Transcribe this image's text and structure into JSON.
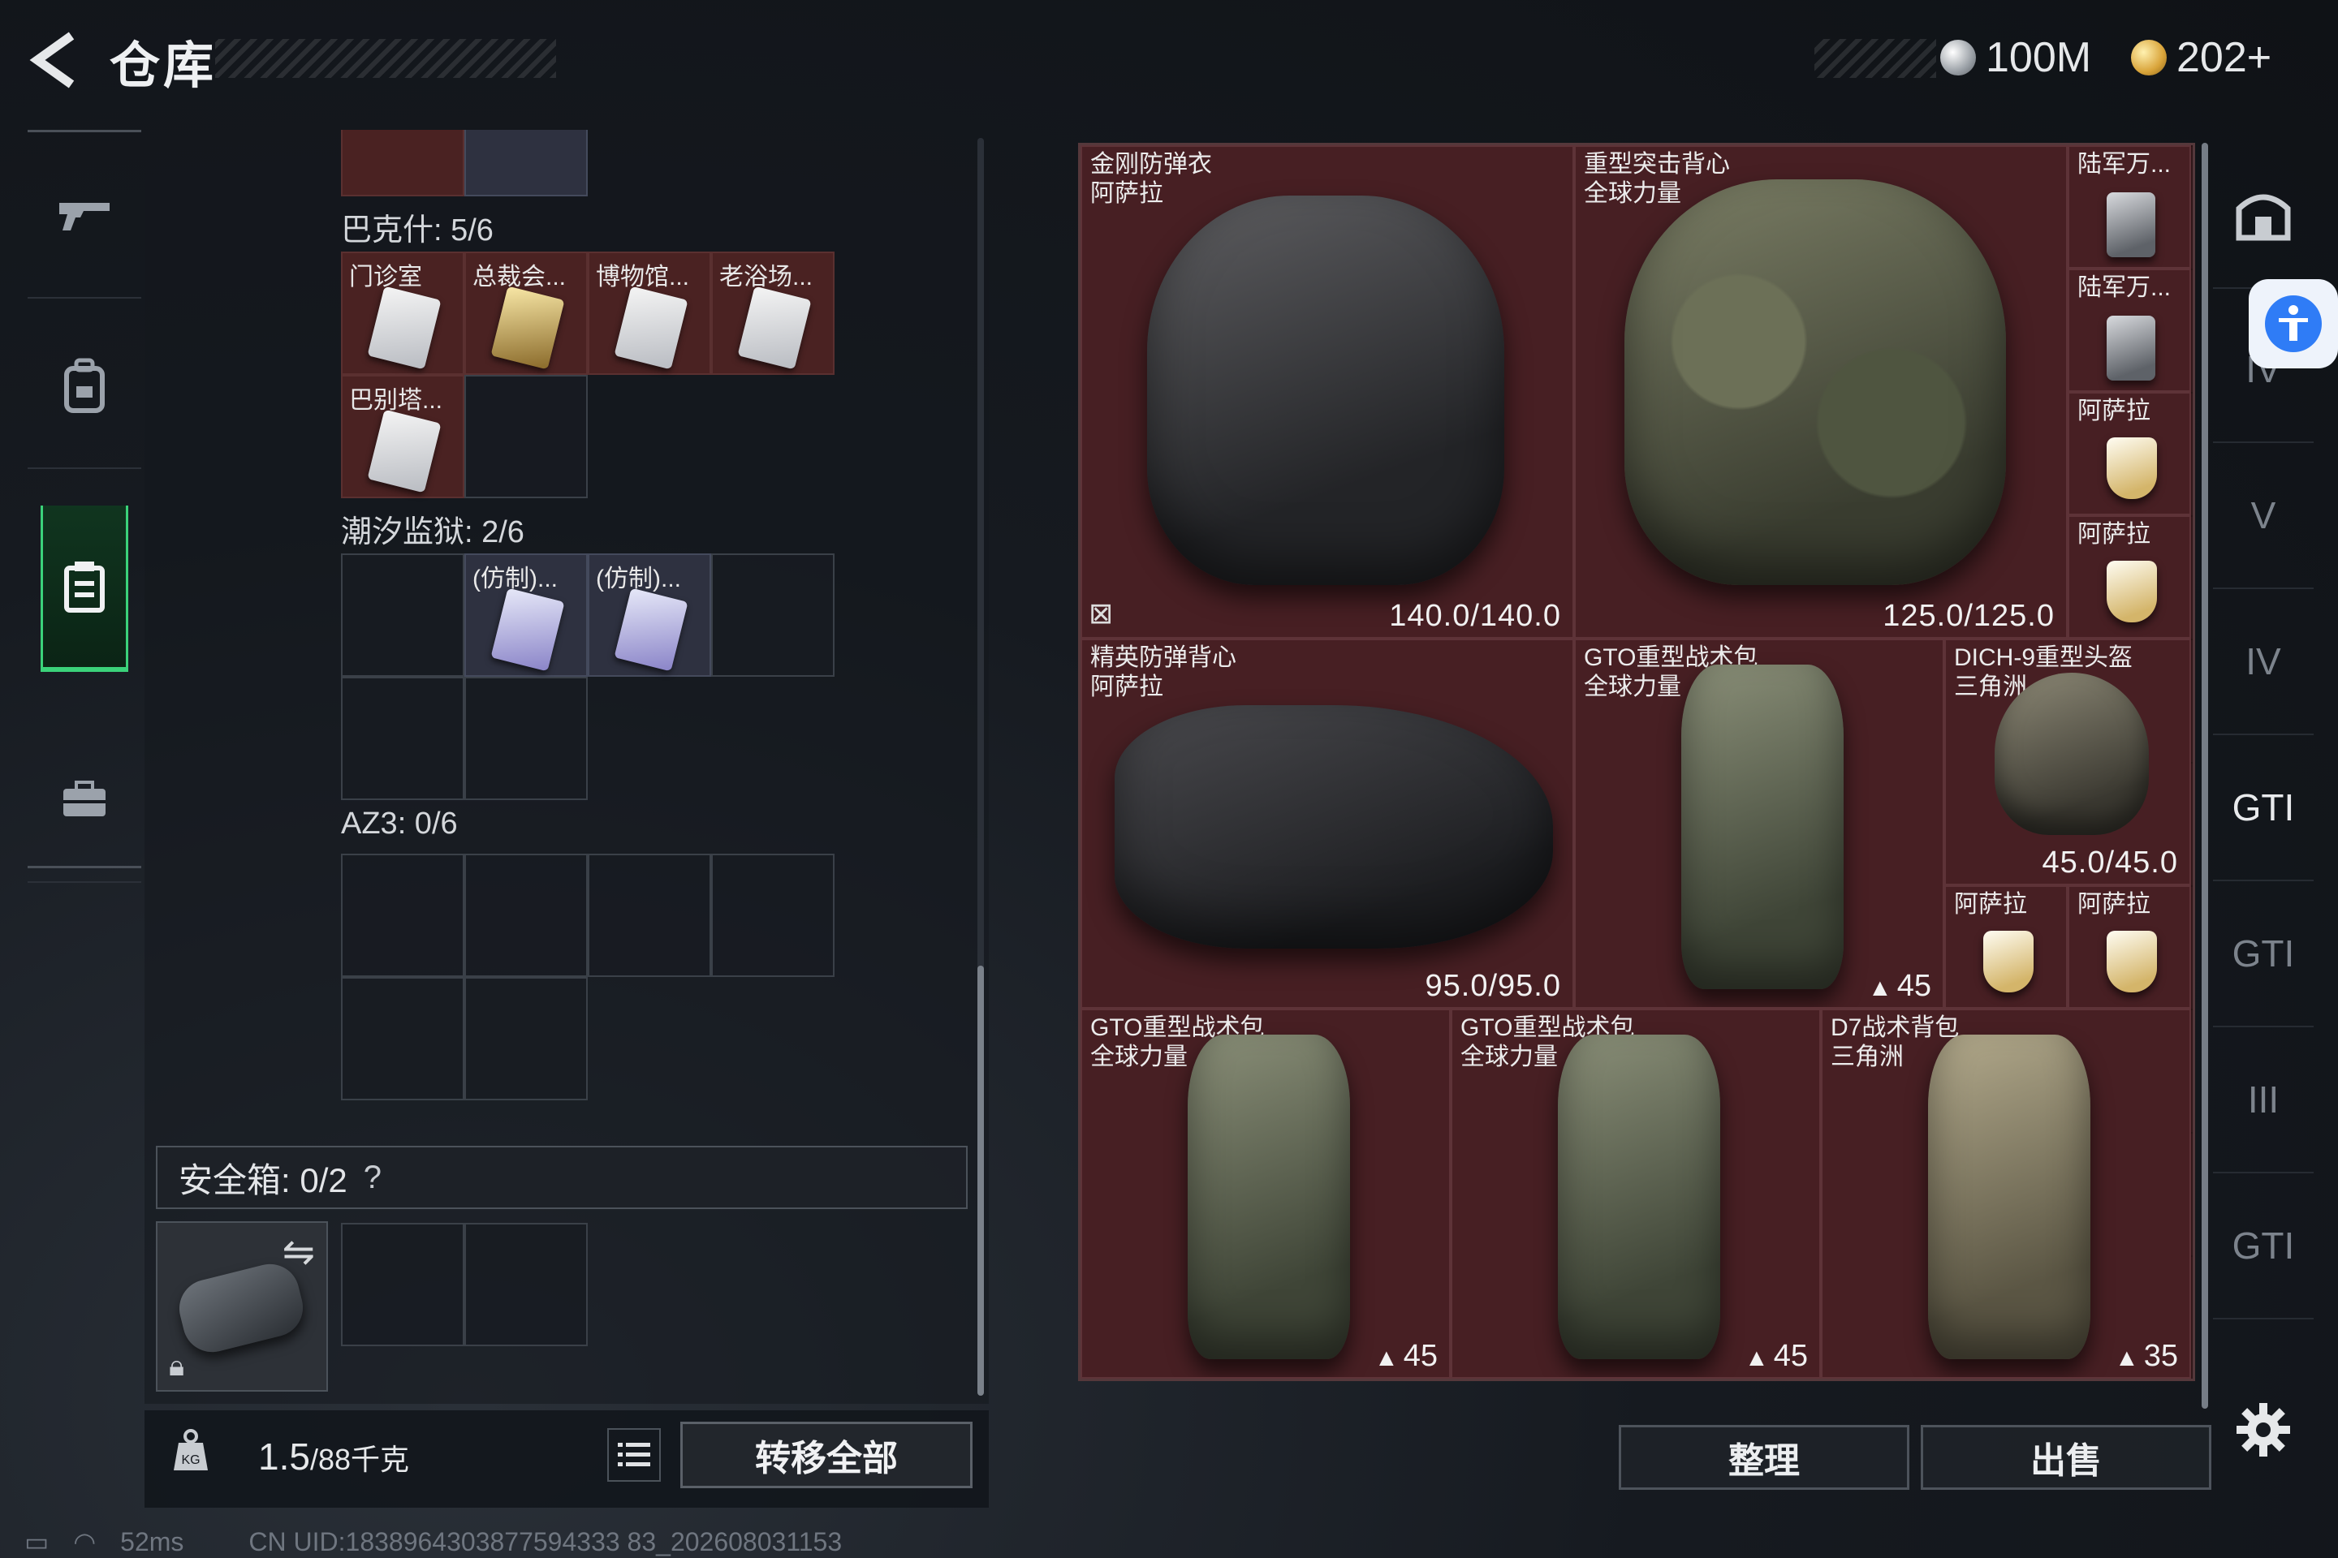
{
  "header": {
    "back_icon": "chevron-left-icon",
    "title": "仓库",
    "currency_silver": "100M",
    "currency_gold": "202+",
    "silver_icon": "silver-coin-icon",
    "gold_icon": "gold-coin-icon"
  },
  "categories": [
    {
      "icon": "gun-icon",
      "glyph": "╤"
    },
    {
      "icon": "backpack-icon",
      "glyph": "◫"
    },
    {
      "icon": "container-icon",
      "glyph": "▤",
      "active": true
    },
    {
      "icon": "briefcase-icon",
      "glyph": "▬"
    }
  ],
  "containers": {
    "bakshi": {
      "label": "巴克什: 5/6",
      "items": [
        "门诊室",
        "总裁会...",
        "博物馆...",
        "老浴场...",
        "巴别塔..."
      ]
    },
    "tidal_prison": {
      "label": "潮汐监狱: 2/6",
      "items": [
        "(仿制)...",
        "(仿制)..."
      ]
    },
    "az3": {
      "label": "AZ3: 0/6"
    }
  },
  "safe_box": {
    "label": "安全箱: 0/2",
    "help": "?"
  },
  "footer": {
    "weight_value": "1.5",
    "weight_max": "/88千克",
    "transfer_all": "转移全部",
    "list_icon": "list-icon",
    "organize": "整理",
    "sell": "出售"
  },
  "status": {
    "ping": "52ms",
    "uid": "CN UID:1838964303877594333 83_202608031153"
  },
  "stash": {
    "armor_1": {
      "name": "金刚防弹衣",
      "sub": "阿萨拉",
      "durability": "140.0/140.0"
    },
    "armor_2": {
      "name": "重型突击背心",
      "sub": "全球力量",
      "durability": "125.0/125.0"
    },
    "armor_3": {
      "name": "精英防弹背心",
      "sub": "阿萨拉",
      "durability": "95.0/95.0"
    },
    "pack_1": {
      "name": "GTO重型战术包",
      "sub": "全球力量",
      "capacity": "45"
    },
    "helmet_1": {
      "name": "DICH-9重型头盔",
      "sub": "三角洲",
      "durability": "45.0/45.0"
    },
    "small_1": {
      "name": "陆军万..."
    },
    "small_2": {
      "name": "陆军万..."
    },
    "small_3": {
      "name": "阿萨拉"
    },
    "small_4": {
      "name": "阿萨拉"
    },
    "small_5": {
      "name": "阿萨拉"
    },
    "small_6": {
      "name": "阿萨拉"
    },
    "pack_2": {
      "name": "GTO重型战术包",
      "sub": "全球力量",
      "capacity": "45"
    },
    "pack_3": {
      "name": "GTO重型战术包",
      "sub": "全球力量",
      "capacity": "45"
    },
    "pack_4": {
      "name": "D7战术背包",
      "sub": "三角洲",
      "capacity": "35"
    }
  },
  "stash_tabs": [
    "IV",
    "V",
    "IV",
    "GTI",
    "GTI",
    "III",
    "GTI"
  ],
  "colors": {
    "accent_green": "#3bd27a",
    "item_bg": "#471f23",
    "a11y_blue": "#2f7cf6"
  }
}
